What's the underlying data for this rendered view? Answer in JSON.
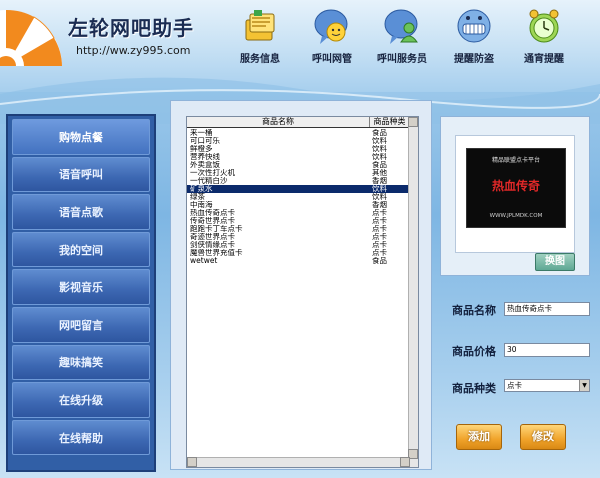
{
  "header": {
    "title": "左轮网吧助手",
    "url": "http://ww.zy995.com",
    "nav": [
      {
        "label": "服务信息",
        "icon": "notebook-icon"
      },
      {
        "label": "呼叫网管",
        "icon": "smiley-bubble-icon"
      },
      {
        "label": "呼叫服务员",
        "icon": "person-bubble-icon"
      },
      {
        "label": "提醒防盗",
        "icon": "grin-face-icon"
      },
      {
        "label": "通宵提醒",
        "icon": "alarm-clock-icon"
      }
    ]
  },
  "sidebar": {
    "items": [
      {
        "label": "购物点餐"
      },
      {
        "label": "语音呼叫"
      },
      {
        "label": "语音点歌"
      },
      {
        "label": "我的空间"
      },
      {
        "label": "影视音乐"
      },
      {
        "label": "网吧留言"
      },
      {
        "label": "趣味搞笑"
      },
      {
        "label": "在线升级"
      },
      {
        "label": "在线帮助"
      }
    ]
  },
  "product_list": {
    "columns": [
      "商品名称",
      "商品种类"
    ],
    "rows": [
      [
        "来一桶",
        "食品"
      ],
      [
        "可口可乐",
        "饮料"
      ],
      [
        "鲜橙多",
        "饮料"
      ],
      [
        "营养快线",
        "饮料"
      ],
      [
        "外卖盒饭",
        "食品"
      ],
      [
        "一次性打火机",
        "其他"
      ],
      [
        "一代精白沙",
        "香烟"
      ],
      [
        "矿泉水",
        "饮料"
      ],
      [
        "绿茶",
        "饮料"
      ],
      [
        "中南海",
        "香烟"
      ],
      [
        "热血传奇点卡",
        "点卡"
      ],
      [
        "传奇世界点卡",
        "点卡"
      ],
      [
        "跑跑卡丁车点卡",
        "点卡"
      ],
      [
        "奇迹世界点卡",
        "点卡"
      ],
      [
        "剑侠情缘点卡",
        "点卡"
      ],
      [
        "魔兽世界充值卡",
        "点卡"
      ],
      [
        "wetwet",
        "食品"
      ]
    ],
    "selected_index": 7
  },
  "preview": {
    "banner_top": "精品联盟点卡平台",
    "banner_title": "热血传奇",
    "banner_url": "WWW.JPLMDK.COM",
    "change_button": "换图"
  },
  "form": {
    "name_label": "商品名称",
    "name_value": "热血传奇点卡",
    "price_label": "商品价格",
    "price_value": "30",
    "type_label": "商品种类",
    "type_value": "点卡"
  },
  "actions": {
    "add": "添加",
    "edit": "修改"
  },
  "colors": {
    "sidebar_bg": "#315fa6",
    "selected_row": "#0b2a6b",
    "action_button": "#f0a32a"
  }
}
